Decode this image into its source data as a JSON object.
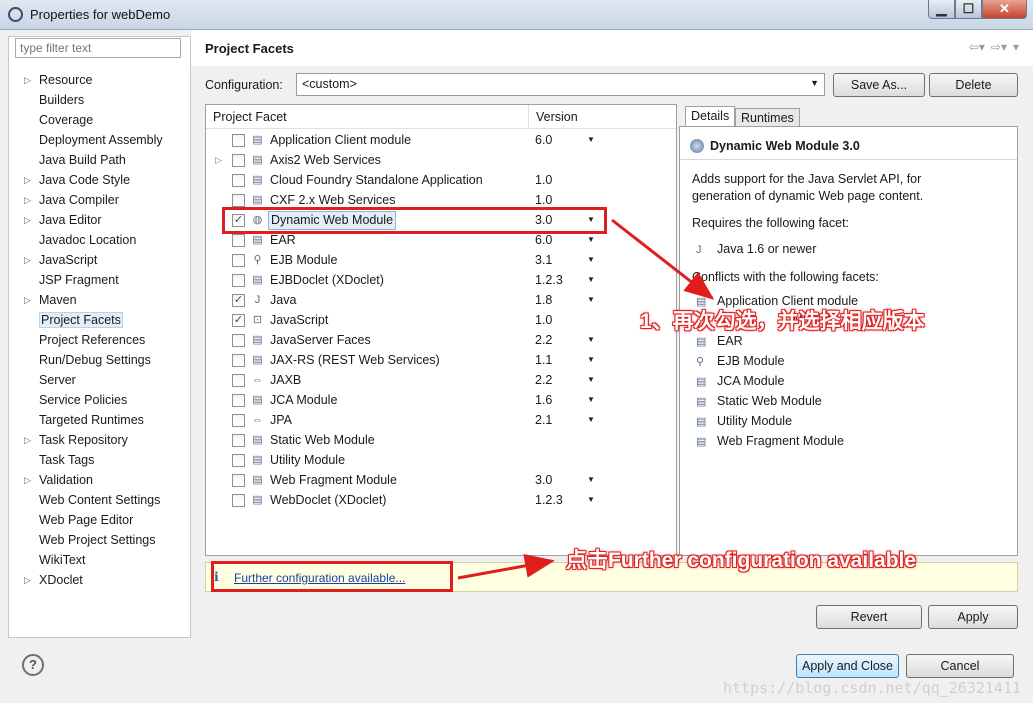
{
  "window": {
    "title": "Properties for webDemo"
  },
  "filter": {
    "placeholder": "type filter text"
  },
  "sidebar": {
    "items": [
      {
        "label": "Resource",
        "expandable": true
      },
      {
        "label": "Builders",
        "expandable": false
      },
      {
        "label": "Coverage",
        "expandable": false
      },
      {
        "label": "Deployment Assembly",
        "expandable": false
      },
      {
        "label": "Java Build Path",
        "expandable": false
      },
      {
        "label": "Java Code Style",
        "expandable": true
      },
      {
        "label": "Java Compiler",
        "expandable": true
      },
      {
        "label": "Java Editor",
        "expandable": true
      },
      {
        "label": "Javadoc Location",
        "expandable": false
      },
      {
        "label": "JavaScript",
        "expandable": true
      },
      {
        "label": "JSP Fragment",
        "expandable": false
      },
      {
        "label": "Maven",
        "expandable": true
      },
      {
        "label": "Project Facets",
        "expandable": false,
        "selected": true
      },
      {
        "label": "Project References",
        "expandable": false
      },
      {
        "label": "Run/Debug Settings",
        "expandable": false
      },
      {
        "label": "Server",
        "expandable": false
      },
      {
        "label": "Service Policies",
        "expandable": false
      },
      {
        "label": "Targeted Runtimes",
        "expandable": false
      },
      {
        "label": "Task Repository",
        "expandable": true
      },
      {
        "label": "Task Tags",
        "expandable": false
      },
      {
        "label": "Validation",
        "expandable": true
      },
      {
        "label": "Web Content Settings",
        "expandable": false
      },
      {
        "label": "Web Page Editor",
        "expandable": false
      },
      {
        "label": "Web Project Settings",
        "expandable": false
      },
      {
        "label": "WikiText",
        "expandable": false
      },
      {
        "label": "XDoclet",
        "expandable": true
      }
    ]
  },
  "page": {
    "title": "Project Facets",
    "configuration_label": "Configuration:",
    "configuration_value": "<custom>",
    "save_as_label": "Save As...",
    "delete_label": "Delete"
  },
  "facets": {
    "col_facet": "Project Facet",
    "col_version": "Version",
    "rows": [
      {
        "name": "Application Client module",
        "version": "6.0",
        "checked": false,
        "dropdown": true,
        "expand": false,
        "icon": "page-icon"
      },
      {
        "name": "Axis2 Web Services",
        "version": "",
        "checked": false,
        "dropdown": false,
        "expand": true,
        "icon": "page-icon"
      },
      {
        "name": "Cloud Foundry Standalone Application",
        "version": "1.0",
        "checked": false,
        "dropdown": false,
        "expand": false,
        "icon": "page-icon"
      },
      {
        "name": "CXF 2.x Web Services",
        "version": "1.0",
        "checked": false,
        "dropdown": false,
        "expand": false,
        "icon": "page-icon"
      },
      {
        "name": "Dynamic Web Module",
        "version": "3.0",
        "checked": true,
        "dropdown": true,
        "expand": false,
        "icon": "globe-icon",
        "highlight": true
      },
      {
        "name": "EAR",
        "version": "6.0",
        "checked": false,
        "dropdown": true,
        "expand": false,
        "icon": "page-icon"
      },
      {
        "name": "EJB Module",
        "version": "3.1",
        "checked": false,
        "dropdown": true,
        "expand": false,
        "icon": "bean-icon"
      },
      {
        "name": "EJBDoclet (XDoclet)",
        "version": "1.2.3",
        "checked": false,
        "dropdown": true,
        "expand": false,
        "icon": "page-icon"
      },
      {
        "name": "Java",
        "version": "1.8",
        "checked": true,
        "dropdown": true,
        "expand": false,
        "icon": "java-icon"
      },
      {
        "name": "JavaScript",
        "version": "1.0",
        "checked": true,
        "dropdown": false,
        "expand": false,
        "icon": "lock-page-icon"
      },
      {
        "name": "JavaServer Faces",
        "version": "2.2",
        "checked": false,
        "dropdown": true,
        "expand": false,
        "icon": "page-icon"
      },
      {
        "name": "JAX-RS (REST Web Services)",
        "version": "1.1",
        "checked": false,
        "dropdown": true,
        "expand": false,
        "icon": "page-icon"
      },
      {
        "name": "JAXB",
        "version": "2.2",
        "checked": false,
        "dropdown": true,
        "expand": false,
        "icon": "arrows-icon"
      },
      {
        "name": "JCA Module",
        "version": "1.6",
        "checked": false,
        "dropdown": true,
        "expand": false,
        "icon": "page-icon"
      },
      {
        "name": "JPA",
        "version": "2.1",
        "checked": false,
        "dropdown": true,
        "expand": false,
        "icon": "arrows-icon"
      },
      {
        "name": "Static Web Module",
        "version": "",
        "checked": false,
        "dropdown": false,
        "expand": false,
        "icon": "page-icon"
      },
      {
        "name": "Utility Module",
        "version": "",
        "checked": false,
        "dropdown": false,
        "expand": false,
        "icon": "page-icon"
      },
      {
        "name": "Web Fragment Module",
        "version": "3.0",
        "checked": false,
        "dropdown": true,
        "expand": false,
        "icon": "page-icon"
      },
      {
        "name": "WebDoclet (XDoclet)",
        "version": "1.2.3",
        "checked": false,
        "dropdown": true,
        "expand": false,
        "icon": "page-icon"
      }
    ]
  },
  "details": {
    "tab_details": "Details",
    "tab_runtimes": "Runtimes",
    "title": "Dynamic Web Module 3.0",
    "desc_line1": "Adds support for the Java Servlet API, for",
    "desc_line2": "generation of dynamic Web page content.",
    "requires_label": "Requires the following facet:",
    "requires_item": "Java 1.6 or newer",
    "conflicts_label": "Conflicts with the following facets:",
    "conflicts": [
      "Application Client module",
      "M",
      "EAR",
      "EJB Module",
      "JCA Module",
      "Static Web Module",
      "Utility Module",
      "Web Fragment Module"
    ]
  },
  "info": {
    "link": "Further configuration available..."
  },
  "buttons": {
    "revert": "Revert",
    "apply": "Apply",
    "apply_close": "Apply and Close",
    "cancel": "Cancel"
  },
  "annotations": {
    "note1": "1、再次勾选，并选择相应版本",
    "note2": "点击Further configuration available",
    "color": "#e21d1d"
  },
  "watermark": "https://blog.csdn.net/qq_26321411"
}
